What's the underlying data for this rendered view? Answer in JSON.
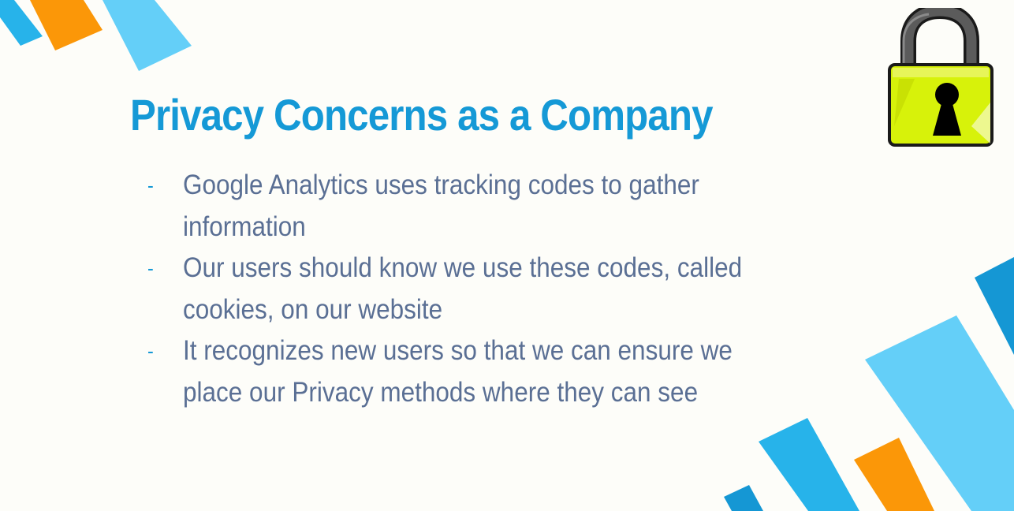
{
  "slide": {
    "title": "Privacy Concerns as a Company",
    "bullet_marker": "-",
    "bullets": [
      {
        "text": "Google Analytics uses tracking codes to gather information"
      },
      {
        "text": "Our users should know we use these codes, called cookies, on our website"
      },
      {
        "text": "It recognizes new users so that we can ensure we place our Privacy methods where they can see"
      }
    ]
  },
  "icons": {
    "lock": "padlock-icon"
  },
  "colors": {
    "background": "#fdfdf9",
    "title": "#1599d6",
    "body_text": "#5a6f94",
    "bullet_marker": "#1599d6",
    "stripe_blue": "#27b3ea",
    "stripe_light_blue": "#64cff8",
    "stripe_dark_blue": "#1597d4",
    "stripe_orange": "#fb9708",
    "lock_body": "#d7f20a",
    "lock_shackle": "#5b5b5b"
  }
}
